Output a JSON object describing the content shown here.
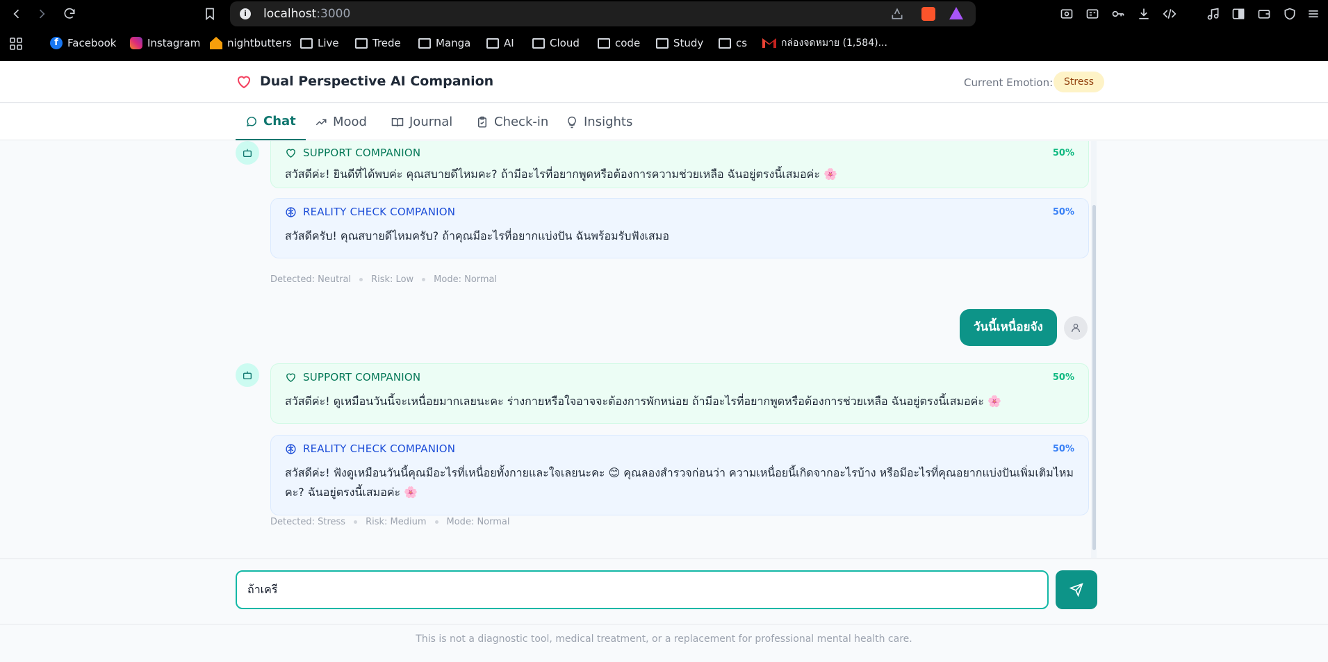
{
  "browser": {
    "url_host": "localhost",
    "url_port": ":3000",
    "bookmarks": [
      {
        "label": "Facebook",
        "icon": "facebook-icon"
      },
      {
        "label": "Instagram",
        "icon": "instagram-icon"
      },
      {
        "label": "nightbutters",
        "icon": "house-icon"
      },
      {
        "label": "Live",
        "icon": "folder-icon"
      },
      {
        "label": "Trede",
        "icon": "folder-icon"
      },
      {
        "label": "Manga",
        "icon": "folder-icon"
      },
      {
        "label": "AI",
        "icon": "folder-icon"
      },
      {
        "label": "Cloud",
        "icon": "folder-icon"
      },
      {
        "label": "code",
        "icon": "folder-icon"
      },
      {
        "label": "Study",
        "icon": "folder-icon"
      },
      {
        "label": "cs",
        "icon": "folder-icon"
      },
      {
        "label": "กล่องจดหมาย (1,584)...",
        "icon": "gmail-icon"
      }
    ]
  },
  "header": {
    "title": "Dual Perspective AI Companion",
    "emotion_label": "Current Emotion:",
    "emotion_value": "Stress"
  },
  "tabs": [
    {
      "label": "Chat",
      "icon": "chat-bubble-icon",
      "active": true
    },
    {
      "label": "Mood",
      "icon": "trending-up-icon",
      "active": false
    },
    {
      "label": "Journal",
      "icon": "book-icon",
      "active": false
    },
    {
      "label": "Check-in",
      "icon": "clipboard-check-icon",
      "active": false
    },
    {
      "label": "Insights",
      "icon": "lightbulb-icon",
      "active": false
    }
  ],
  "messages": [
    {
      "type": "bot",
      "support": {
        "title": "SUPPORT COMPANION",
        "percent": "50%",
        "text": "สวัสดีค่ะ! ยินดีที่ได้พบค่ะ คุณสบายดีไหมคะ? ถ้ามีอะไรที่อยากพูดหรือต้องการความช่วยเหลือ ฉันอยู่ตรงนี้เสมอค่ะ 🌸"
      },
      "reality": {
        "title": "REALITY CHECK COMPANION",
        "percent": "50%",
        "text": "สวัสดีครับ! คุณสบายดีไหมครับ? ถ้าคุณมีอะไรที่อยากแบ่งปัน ฉันพร้อมรับฟังเสมอ"
      },
      "meta": {
        "detected": "Detected: Neutral",
        "risk": "Risk: Low",
        "mode": "Mode: Normal"
      }
    },
    {
      "type": "user",
      "text": "วันนี้เหนื่อยจัง"
    },
    {
      "type": "bot",
      "support": {
        "title": "SUPPORT COMPANION",
        "percent": "50%",
        "text": "สวัสดีค่ะ! ดูเหมือนวันนี้จะเหนื่อยมากเลยนะคะ ร่างกายหรือใจอาจจะต้องการพักหน่อย ถ้ามีอะไรที่อยากพูดหรือต้องการช่วยเหลือ ฉันอยู่ตรงนี้เสมอค่ะ 🌸"
      },
      "reality": {
        "title": "REALITY CHECK COMPANION",
        "percent": "50%",
        "text": "สวัสดีค่ะ! ฟังดูเหมือนวันนี้คุณมีอะไรที่เหนื่อยทั้งกายและใจเลยนะคะ 😊 คุณลองสำรวจก่อนว่า ความเหนื่อยนี้เกิดจากอะไรบ้าง หรือมีอะไรที่คุณอยากแบ่งปันเพิ่มเติมไหมคะ? ฉันอยู่ตรงนี้เสมอค่ะ 🌸"
      },
      "meta": {
        "detected": "Detected: Stress",
        "risk": "Risk: Medium",
        "mode": "Mode: Normal"
      }
    }
  ],
  "input": {
    "value": "ถ้าเครี"
  },
  "footer": {
    "text": "This is not a diagnostic tool, medical treatment, or a replacement for professional mental health care."
  },
  "colors": {
    "accent": "#0d9488",
    "support_bg": "#ecfdf5",
    "reality_bg": "#eff6ff",
    "emotion_badge": "#fef3c7"
  }
}
